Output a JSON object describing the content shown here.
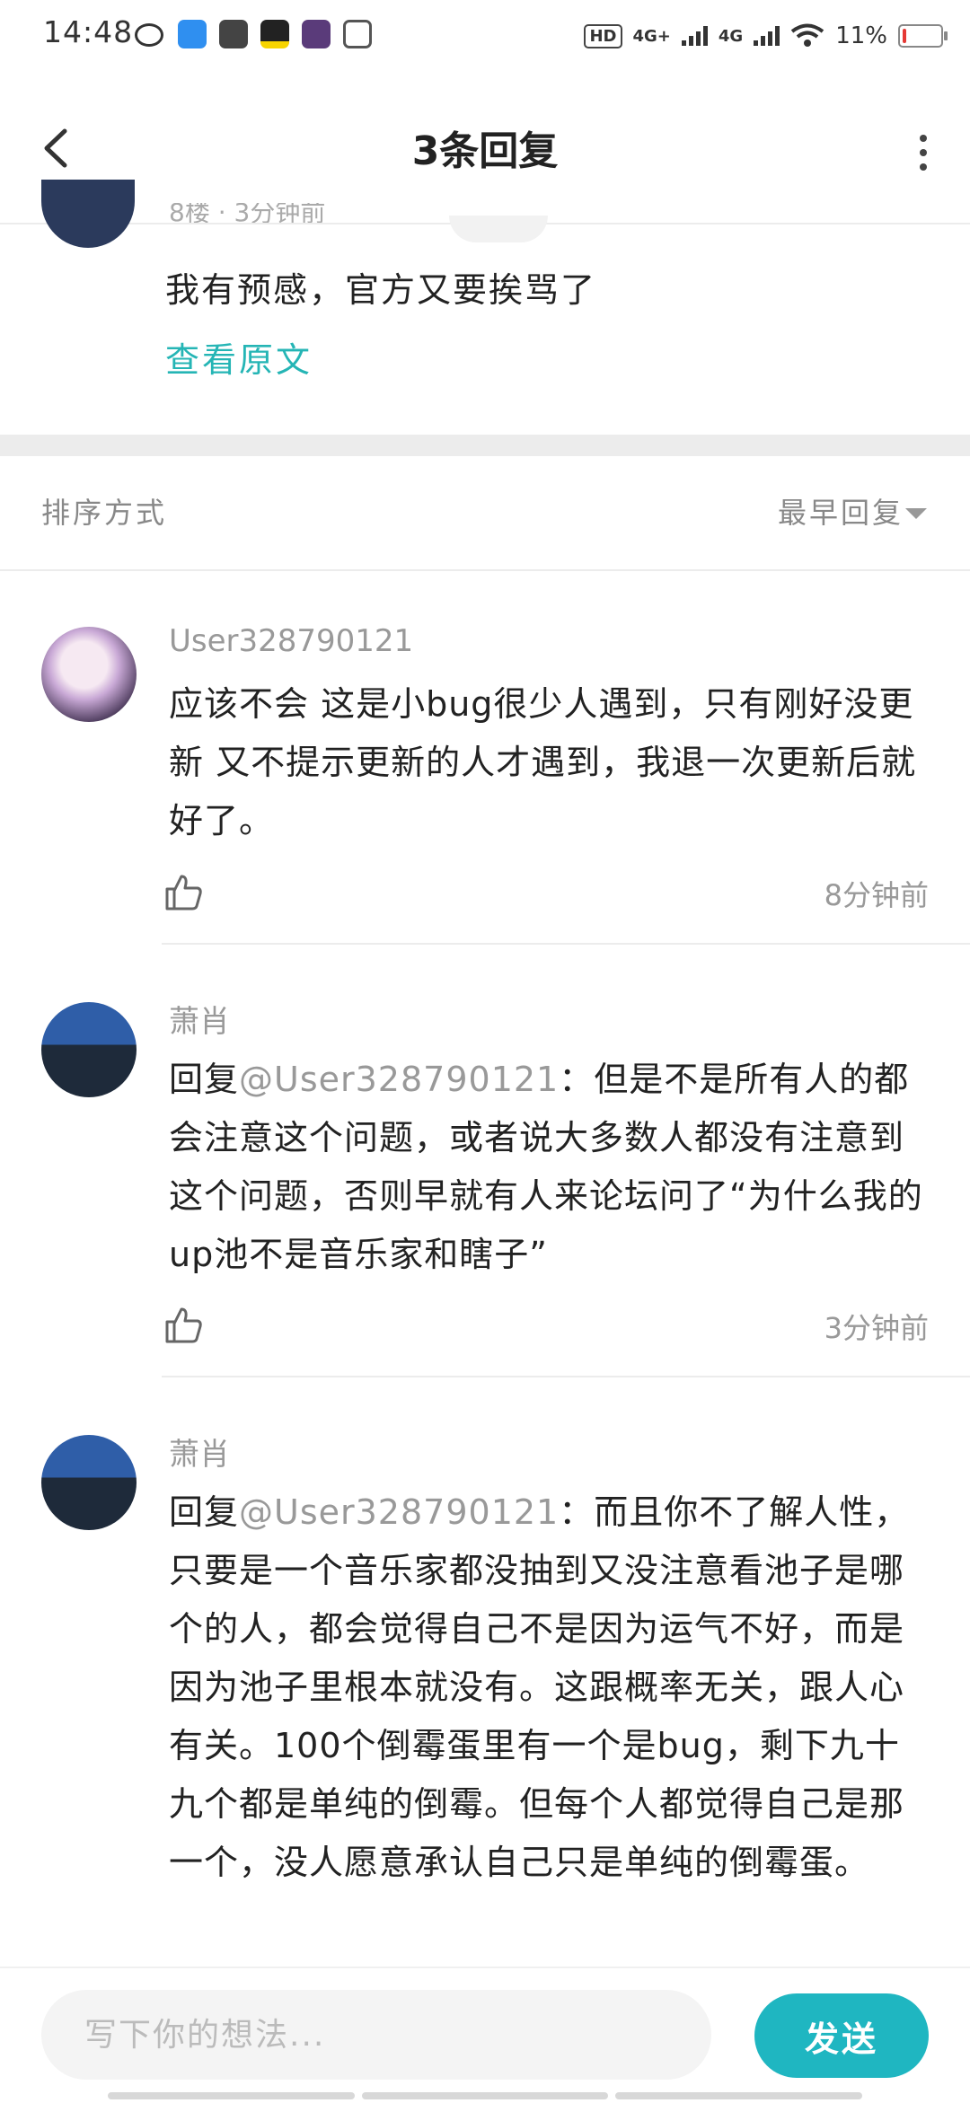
{
  "status_bar": {
    "time": "14:48",
    "hd_badge": "HD",
    "net1": "4G+",
    "net2": "4G",
    "battery": "11%",
    "battery_level": 0.11,
    "app_icons": [
      "weibo-icon",
      "wifi-app-icon",
      "game-icon",
      "news-icon",
      "k-app-icon",
      "z-app-icon"
    ]
  },
  "nav": {
    "title": "3条回复"
  },
  "original_post": {
    "meta": "8楼 · 3分钟前",
    "text": "我有预感，官方又要挨骂了",
    "view_original": "查看原文"
  },
  "sort": {
    "label": "排序方式",
    "value": "最早回复"
  },
  "replies": [
    {
      "user": "User328790121",
      "text": "应该不会 这是小bug很少人遇到，只有刚好没更新 又不提示更新的人才遇到，我退一次更新后就好了。",
      "time": "8分钟前"
    },
    {
      "user": "萧肖",
      "reply_prefix": "回复",
      "mention": "@User328790121",
      "text": "：但是不是所有人的都会注意这个问题，或者说大多数人都没有注意到这个问题，否则早就有人来论坛问了“为什么我的up池不是音乐家和瞎子”",
      "time": "3分钟前"
    },
    {
      "user": "萧肖",
      "reply_prefix": "回复",
      "mention": "@User328790121",
      "text": "：而且你不了解人性，只要是一个音乐家都没抽到又没注意看池子是哪个的人，都会觉得自己不是因为运气不好，而是因为池子里根本就没有。这跟概率无关，跟人心有关。100个倒霉蛋里有一个是bug，剩下九十九个都是单纯的倒霉。但每个人都觉得自己是那一个，没人愿意承认自己只是单纯的倒霉蛋。"
    }
  ],
  "composer": {
    "placeholder": "写下你的想法...",
    "send_label": "发送"
  },
  "colors": {
    "accent": "#1fb6c1",
    "link": "#25b5b5",
    "muted": "#999999"
  }
}
